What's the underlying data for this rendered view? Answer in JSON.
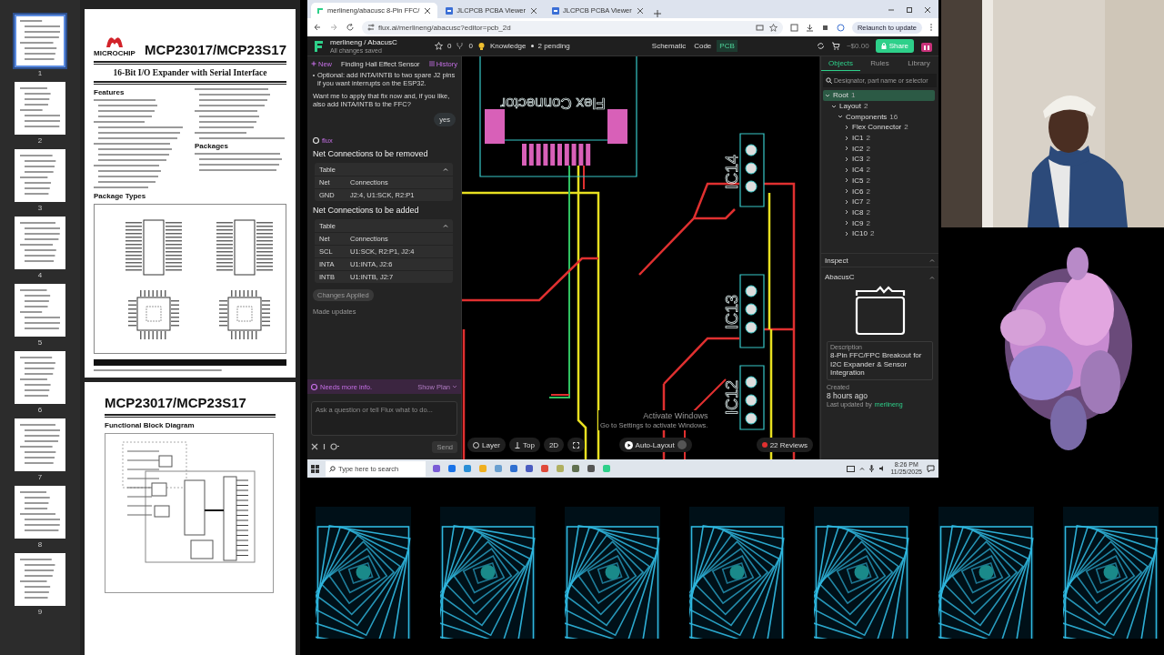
{
  "pdf_viewer": {
    "thumbnails": [
      {
        "label": "1",
        "selected": true
      },
      {
        "label": "2",
        "selected": false
      },
      {
        "label": "3",
        "selected": false
      },
      {
        "label": "4",
        "selected": false
      },
      {
        "label": "5",
        "selected": false
      },
      {
        "label": "6",
        "selected": false
      },
      {
        "label": "7",
        "selected": false
      },
      {
        "label": "8",
        "selected": false
      },
      {
        "label": "9",
        "selected": false
      }
    ],
    "page_1": {
      "logo_text": "MICROCHIP",
      "title": "MCP23017/MCP23S17",
      "subtitle": "16-Bit I/O Expander with Serial Interface",
      "features_heading": "Features",
      "packages_heading": "Packages",
      "package_types_heading": "Package Types"
    },
    "page_2": {
      "title": "MCP23017/MCP23S17",
      "figure_title": "Functional Block Diagram"
    }
  },
  "browser": {
    "tabs": [
      {
        "title": "merlineng/abacusc 8-Pin FFC/",
        "selected": true
      },
      {
        "title": "JLCPCB PCBA Viewer",
        "selected": false
      },
      {
        "title": "JLCPCB PCBA Viewer",
        "selected": false
      }
    ],
    "url": "flux.ai/merlineng/abacusc?editor=pcb_2d",
    "update_button": "Relaunch to update"
  },
  "flux": {
    "header": {
      "project": "merlineng / AbacusC",
      "save_status": "All changes saved",
      "star_count": "0",
      "fork_count": "0",
      "knowledge_label": "Knowledge",
      "knowledge_status": "2 pending",
      "views": [
        {
          "label": "Schematic",
          "selected": false
        },
        {
          "label": "Code",
          "selected": false
        },
        {
          "label": "PCB",
          "selected": true
        }
      ],
      "price": "~$0.00",
      "share": "Share"
    },
    "chat": {
      "new": "New",
      "title": "Finding Hall Effect Sensor",
      "history": "History",
      "bullet": "Optional: add INTA/INTB to two spare J2 pins if you want interrupts on the ESP32.",
      "question": "Want me to apply that fix now and, if you like, also add INTA/INTB to the FFC?",
      "user_reply": "yes",
      "agent": "flux",
      "sections": [
        {
          "heading": "Net Connections to be removed",
          "table_label": "Table",
          "expanded": true,
          "columns": [
            "Net",
            "Connections"
          ],
          "rows": [
            [
              "GND",
              "J2:4, U1:SCK, R2:P1"
            ]
          ]
        },
        {
          "heading": "Net Connections to be added",
          "table_label": "Table",
          "expanded": true,
          "columns": [
            "Net",
            "Connections"
          ],
          "rows": [
            [
              "SCL",
              "U1:SCK, R2:P1, J2:4"
            ],
            [
              "INTA",
              "U1:INTA, J2:6"
            ],
            [
              "INTB",
              "U1:INTB, J2:7"
            ]
          ]
        }
      ],
      "applied_badge": "Changes Applied",
      "status_note": "Made updates",
      "banner": "Needs more info.",
      "show_plan": "Show Plan",
      "input_placeholder": "Ask a question or tell Flux what to do...",
      "send": "Send"
    },
    "canvas": {
      "labels": [
        {
          "kind": "connector",
          "text": "Flex Connector"
        },
        {
          "kind": "ic",
          "text": "IC14"
        },
        {
          "kind": "ic",
          "text": "IC13"
        },
        {
          "kind": "ic",
          "text": "IC12"
        }
      ],
      "toolbar": {
        "layer": "Layer",
        "side": "Top",
        "view": "2D",
        "auto_layout": "Auto-Layout",
        "auto_layout_on": false,
        "reviews": "22 Reviews"
      }
    },
    "objects_panel": {
      "tabs": [
        {
          "label": "Objects",
          "selected": true
        },
        {
          "label": "Rules",
          "selected": false
        },
        {
          "label": "Library",
          "selected": false
        }
      ],
      "search_placeholder": "Designator, part name or selector",
      "tree": [
        {
          "label": "Root",
          "count": "1",
          "expanded": true,
          "selected": true,
          "children": [
            {
              "label": "Layout",
              "count": "2",
              "expanded": true,
              "selected": false,
              "children": [
                {
                  "label": "Components",
                  "count": "16",
                  "expanded": true,
                  "selected": false,
                  "children": [
                    {
                      "label": "Flex Connector",
                      "count": "2",
                      "expanded": false,
                      "selected": false
                    },
                    {
                      "label": "IC1",
                      "count": "2",
                      "expanded": false,
                      "selected": false
                    },
                    {
                      "label": "IC2",
                      "count": "2",
                      "expanded": false,
                      "selected": false
                    },
                    {
                      "label": "IC3",
                      "count": "2",
                      "expanded": false,
                      "selected": false
                    },
                    {
                      "label": "IC4",
                      "count": "2",
                      "expanded": false,
                      "selected": false
                    },
                    {
                      "label": "IC5",
                      "count": "2",
                      "expanded": false,
                      "selected": false
                    },
                    {
                      "label": "IC6",
                      "count": "2",
                      "expanded": false,
                      "selected": false
                    },
                    {
                      "label": "IC7",
                      "count": "2",
                      "expanded": false,
                      "selected": false
                    },
                    {
                      "label": "IC8",
                      "count": "2",
                      "expanded": false,
                      "selected": false
                    },
                    {
                      "label": "IC9",
                      "count": "2",
                      "expanded": false,
                      "selected": false
                    },
                    {
                      "label": "IC10",
                      "count": "2",
                      "expanded": false,
                      "selected": false
                    }
                  ]
                }
              ]
            }
          ]
        }
      ],
      "inspect_heading": "Inspect",
      "object_name": "AbacusC",
      "description_label": "Description",
      "description": "8-Pin FFC/FPC Breakout for I2C Expander & Sensor Integration",
      "created_label": "Created",
      "created": "8 hours ago",
      "updated_label": "Last updated by",
      "updated_by": "merlineng"
    }
  },
  "activation_notice": {
    "title": "Activate Windows",
    "hint": "Go to Settings to activate Windows."
  },
  "taskbar": {
    "search_placeholder": "Type here to search",
    "time": "8:26 PM",
    "date": "11/25/2025"
  },
  "overlay_tiles": [
    {
      "kind": "spiral"
    },
    {
      "kind": "spiral"
    },
    {
      "kind": "spiral"
    },
    {
      "kind": "spiral"
    },
    {
      "kind": "spiral"
    },
    {
      "kind": "spiral"
    },
    {
      "kind": "spiral"
    }
  ]
}
